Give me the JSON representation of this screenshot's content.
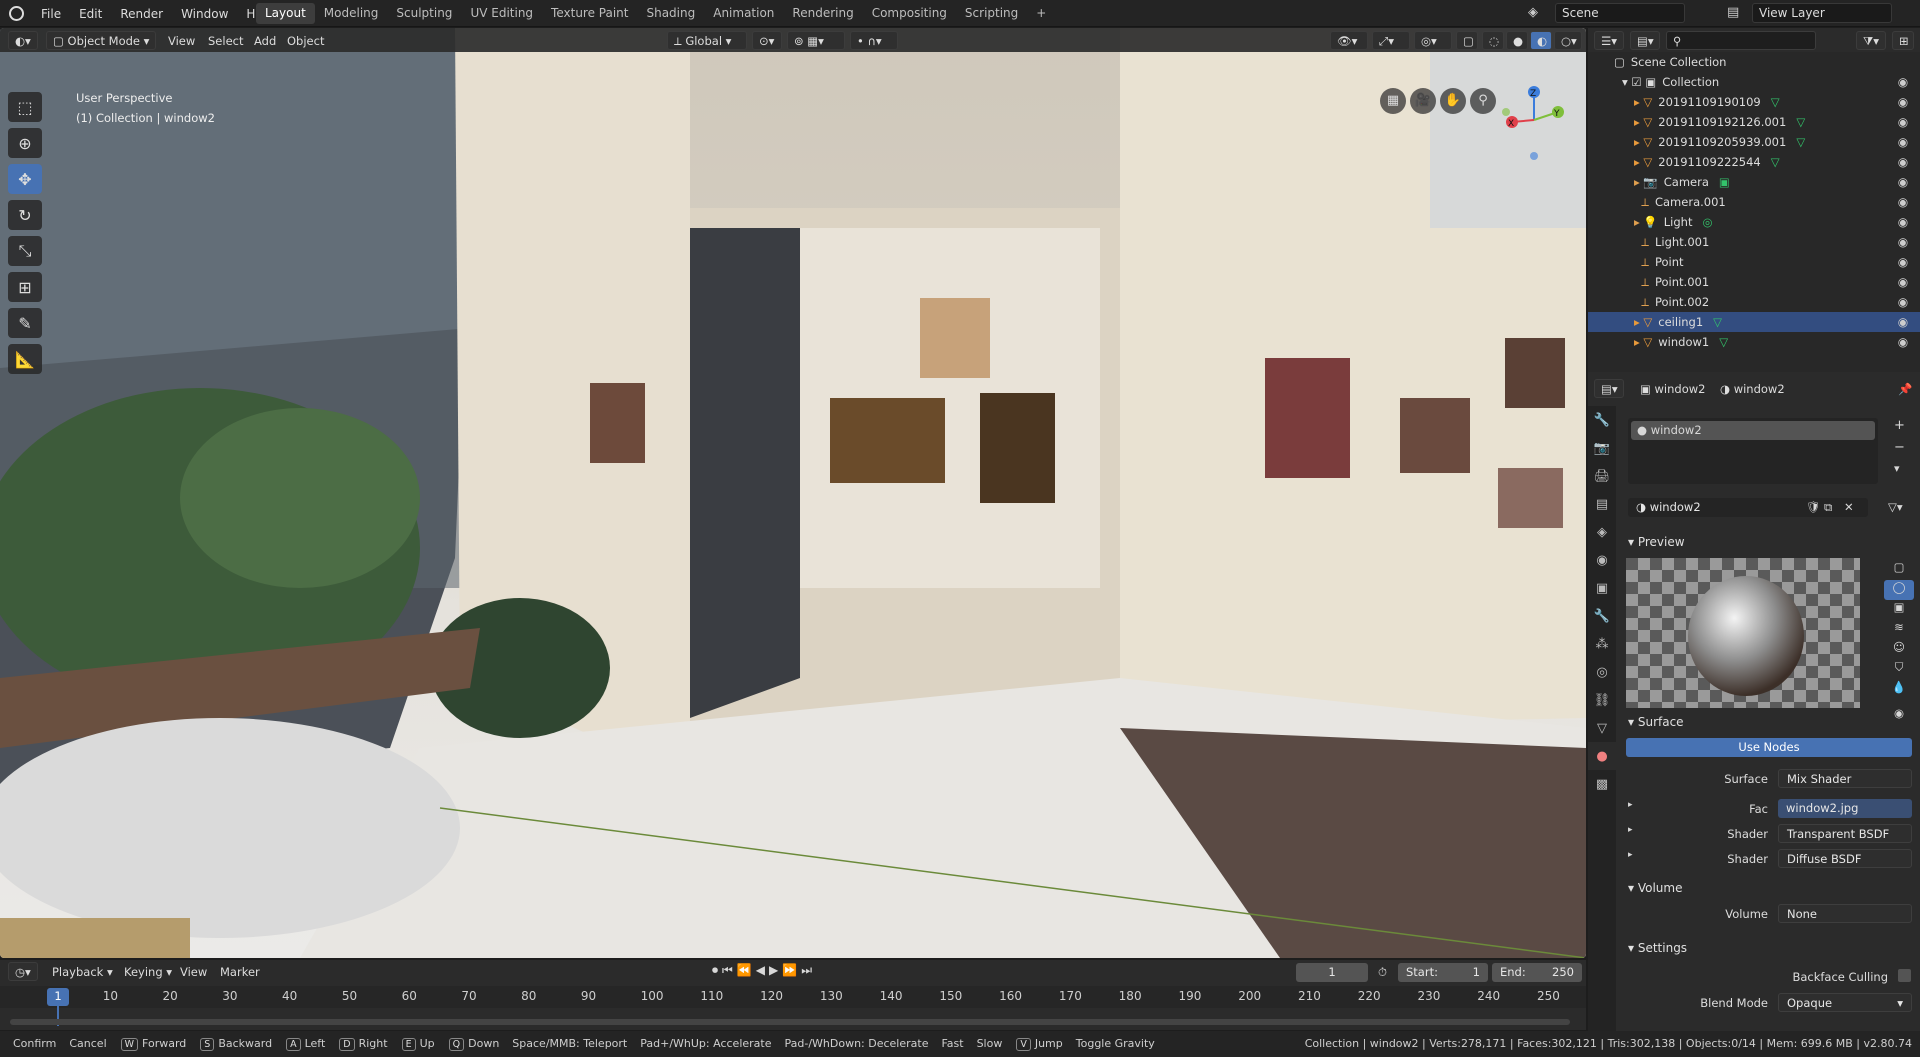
{
  "topbar": {
    "menus": [
      "File",
      "Edit",
      "Render",
      "Window",
      "Help"
    ],
    "workspaces": [
      "Layout",
      "Modeling",
      "Sculpting",
      "UV Editing",
      "Texture Paint",
      "Shading",
      "Animation",
      "Rendering",
      "Compositing",
      "Scripting"
    ],
    "active_workspace": "Layout",
    "scene": "Scene",
    "view_layer": "View Layer"
  },
  "viewport": {
    "mode": "Object Mode",
    "menus": [
      "View",
      "Select",
      "Add",
      "Object"
    ],
    "transform_orientation": "Global",
    "overlay_title": "User Perspective",
    "overlay_subtitle": "(1) Collection | window2",
    "gizmo_axes": {
      "z": "Z",
      "x": "X",
      "y": "Y"
    }
  },
  "outliner": {
    "root": "Scene Collection",
    "collection": "Collection",
    "items": [
      {
        "name": "20191109190109",
        "type": "mesh",
        "selected": false
      },
      {
        "name": "20191109192126.001",
        "type": "mesh",
        "selected": false
      },
      {
        "name": "20191109205939.001",
        "type": "mesh",
        "selected": false
      },
      {
        "name": "20191109222544",
        "type": "mesh",
        "selected": false
      },
      {
        "name": "Camera",
        "type": "camera",
        "selected": false
      },
      {
        "name": "Camera.001",
        "type": "empty",
        "selected": false
      },
      {
        "name": "Light",
        "type": "light",
        "selected": false
      },
      {
        "name": "Light.001",
        "type": "empty",
        "selected": false
      },
      {
        "name": "Point",
        "type": "empty",
        "selected": false
      },
      {
        "name": "Point.001",
        "type": "empty",
        "selected": false
      },
      {
        "name": "Point.002",
        "type": "empty",
        "selected": false
      },
      {
        "name": "ceiling1",
        "type": "mesh",
        "selected": true
      },
      {
        "name": "window1",
        "type": "mesh",
        "selected": false
      }
    ]
  },
  "properties": {
    "object_name": "window2",
    "material_name": "window2",
    "slot_name": "window2",
    "material_selector": "window2",
    "sections": {
      "preview": "Preview",
      "surface": "Surface",
      "volume": "Volume",
      "settings": "Settings"
    },
    "use_nodes_label": "Use Nodes",
    "surface_label": "Surface",
    "surface_value": "Mix Shader",
    "fac_label": "Fac",
    "fac_value": "window2.jpg",
    "shader1_label": "Shader",
    "shader1_value": "Transparent BSDF",
    "shader2_label": "Shader",
    "shader2_value": "Diffuse BSDF",
    "volume_label": "Volume",
    "volume_value": "None",
    "backface_label": "Backface Culling",
    "blend_label": "Blend Mode",
    "blend_value": "Opaque"
  },
  "timeline": {
    "menus": [
      "Playback",
      "Keying",
      "View",
      "Marker"
    ],
    "current_frame": "1",
    "start_label": "Start:",
    "start_value": "1",
    "end_label": "End:",
    "end_value": "250",
    "ticks": [
      "1",
      "10",
      "20",
      "30",
      "40",
      "50",
      "60",
      "70",
      "80",
      "90",
      "100",
      "110",
      "120",
      "130",
      "140",
      "150",
      "160",
      "170",
      "180",
      "190",
      "200",
      "210",
      "220",
      "230",
      "240",
      "250"
    ]
  },
  "statusbar": {
    "hints": [
      {
        "key": "",
        "label": "Confirm"
      },
      {
        "key": "",
        "label": "Cancel"
      },
      {
        "key": "W",
        "label": "Forward"
      },
      {
        "key": "S",
        "label": "Backward"
      },
      {
        "key": "A",
        "label": "Left"
      },
      {
        "key": "D",
        "label": "Right"
      },
      {
        "key": "E",
        "label": "Up"
      },
      {
        "key": "Q",
        "label": "Down"
      },
      {
        "key": "",
        "label": "Space/MMB: Teleport"
      },
      {
        "key": "",
        "label": "Pad+/WhUp: Accelerate"
      },
      {
        "key": "",
        "label": "Pad-/WhDown: Decelerate"
      },
      {
        "key": "",
        "label": "Fast"
      },
      {
        "key": "",
        "label": "Slow"
      },
      {
        "key": "V",
        "label": "Jump"
      },
      {
        "key": "",
        "label": "Toggle Gravity"
      }
    ],
    "stats": "Collection | window2 | Verts:278,171 | Faces:302,121 | Tris:302,138 | Objects:0/14 | Mem: 699.6 MB | v2.80.74"
  },
  "colors": {
    "accent": "#4772b3",
    "selection": "#334d80",
    "mesh_icon": "#e89a3c",
    "data_icon": "#33c46b"
  }
}
